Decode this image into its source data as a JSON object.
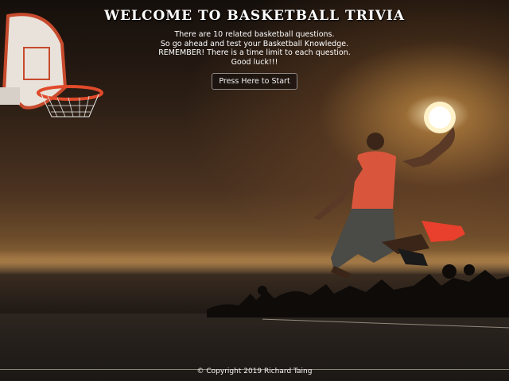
{
  "header": {
    "title": "WELCOME TO BASKETBALL TRIVIA",
    "lines": [
      "There are 10 related basketball questions.",
      "So go ahead and test your Basketball Knowledge.",
      "REMEMBER! There is a time limit to each question.",
      "Good luck!!!"
    ],
    "start_label": "Press Here to Start"
  },
  "footer": {
    "copyright": "© Copyright 2019 Richard Taing"
  },
  "colors": {
    "sun": "#fff2c8",
    "jersey": "#d9563c",
    "hoop_rim": "#e04a2a",
    "backboard": "#e8e0d8"
  }
}
